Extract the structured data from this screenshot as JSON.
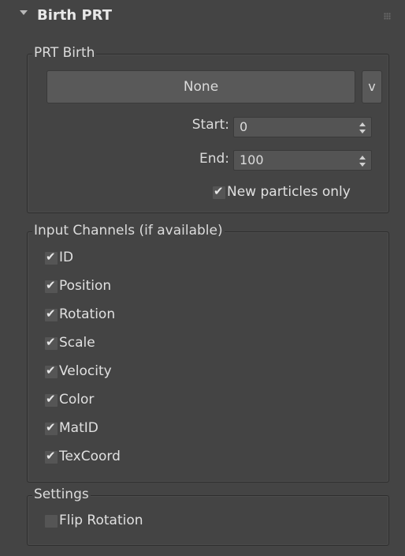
{
  "rollout": {
    "title": "Birth PRT",
    "expanded_icon": "triangle-down-icon",
    "grip_icon": "grip-icon"
  },
  "prt_birth": {
    "group_title": "PRT Birth",
    "pick_button": "None",
    "dropdown_button": "v",
    "start_label": "Start:",
    "start_value": "0",
    "end_label": "End:",
    "end_value": "100",
    "new_particles_only": {
      "label": "New particles only",
      "checked": true
    }
  },
  "input_channels": {
    "group_title": "Input Channels (if available)",
    "items": [
      {
        "label": "ID",
        "checked": true
      },
      {
        "label": "Position",
        "checked": true
      },
      {
        "label": "Rotation",
        "checked": true
      },
      {
        "label": "Scale",
        "checked": true
      },
      {
        "label": "Velocity",
        "checked": true
      },
      {
        "label": "Color",
        "checked": true
      },
      {
        "label": "MatID",
        "checked": true
      },
      {
        "label": "TexCoord",
        "checked": true
      }
    ]
  },
  "settings": {
    "group_title": "Settings",
    "flip_rotation": {
      "label": "Flip Rotation",
      "checked": false
    }
  },
  "glyphs": {
    "check": "✔"
  }
}
